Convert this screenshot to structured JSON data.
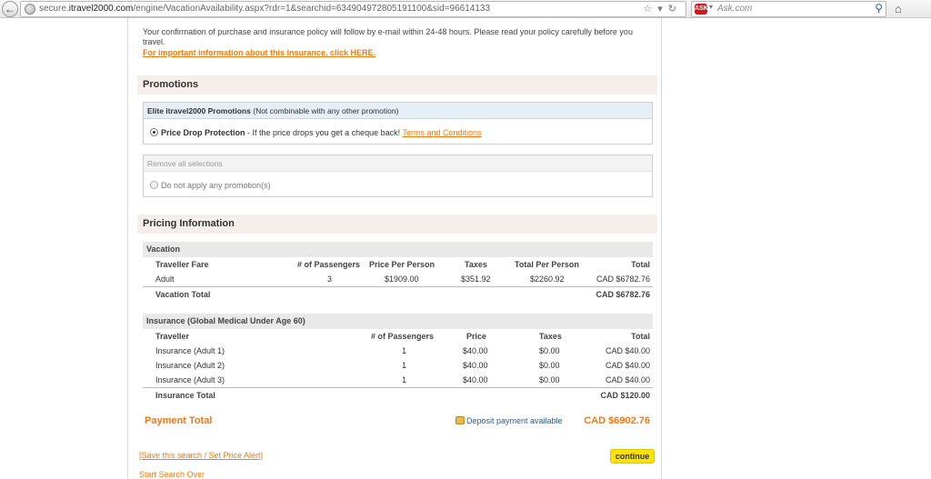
{
  "browser": {
    "url_prefix": "secure.",
    "url_host": "itravel2000.com",
    "url_path": "/engine/VacationAvailability.aspx?rdr=1&searchid=634904972805191100&sid=96614133",
    "search_placeholder": "Ask.com",
    "search_logo": "ASK"
  },
  "notice": {
    "text": "Your confirmation of purchase and insurance policy will follow by e-mail within 24-48 hours. Please read your policy carefully before you travel.",
    "link": "For important information about this insurance, click HERE."
  },
  "promotions": {
    "title": "Promotions",
    "elite_title": "Elite itravel2000 Promotions",
    "elite_note": "(Not combinable with any other promotion)",
    "option_label": "Price Drop Protection",
    "option_desc": " - If the price drops you get a cheque back! ",
    "terms_link": "Terms and Conditions",
    "remove_title": "Remove all selections",
    "none_label": "Do not apply any promotion(s)"
  },
  "pricing": {
    "title": "Pricing Information",
    "vacation": {
      "heading": "Vacation",
      "columns": [
        "Traveller Fare",
        "# of Passengers",
        "Price Per Person",
        "Taxes",
        "Total Per Person",
        "Total"
      ],
      "row": [
        "Adult",
        "3",
        "$1909.00",
        "$351.92",
        "$2260.92",
        "CAD $6782.76"
      ],
      "total_label": "Vacation Total",
      "total_value": "CAD $6782.76"
    },
    "insurance": {
      "heading": "Insurance (Global Medical Under Age 60)",
      "columns": [
        "Traveller",
        "# of Passengers",
        "Price",
        "Taxes",
        "Total"
      ],
      "rows": [
        [
          "Insurance (Adult 1)",
          "1",
          "$40.00",
          "$0.00",
          "CAD $40.00"
        ],
        [
          "Insurance (Adult 2)",
          "1",
          "$40.00",
          "$0.00",
          "CAD $40.00"
        ],
        [
          "Insurance (Adult 3)",
          "1",
          "$40.00",
          "$0.00",
          "CAD $40.00"
        ]
      ],
      "total_label": "Insurance Total",
      "total_value": "CAD $120.00"
    },
    "payment_label": "Payment Total",
    "deposit_label": "Deposit payment available",
    "payment_value": "CAD $6902.76"
  },
  "footer": {
    "save_link": "[Save this search / Set Price Alert]",
    "continue_label": "continue",
    "start_link": "Start Search Over"
  }
}
